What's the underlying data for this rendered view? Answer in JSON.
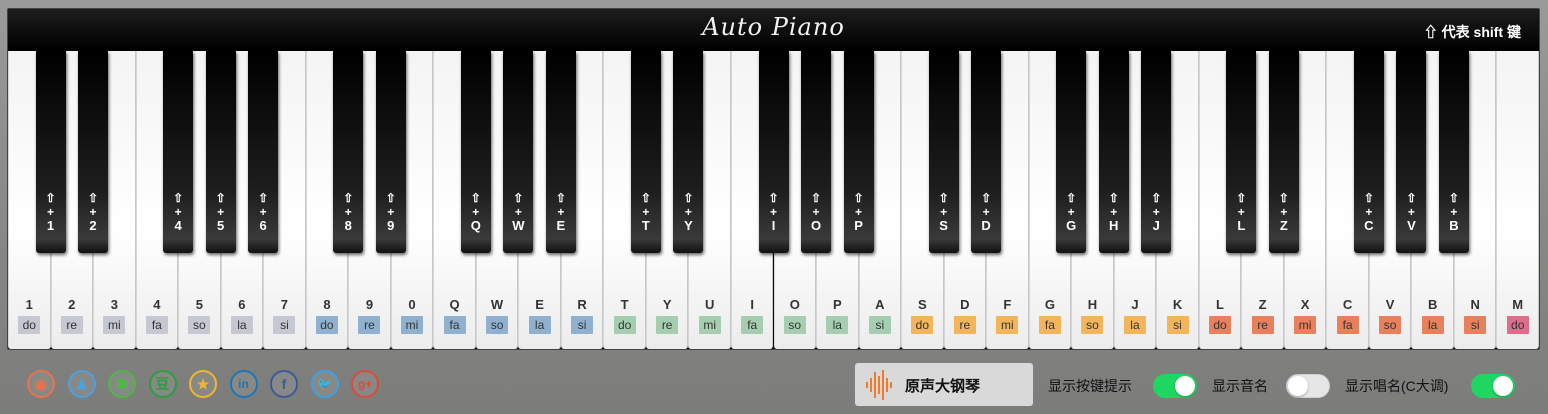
{
  "app": {
    "logo_text": "Auto Piano",
    "shift_hint": "⇧ 代表 shift 键"
  },
  "colors": {
    "group1": "#c5c8d2",
    "group2": "#8fb0cf",
    "group3": "#a5cdaf",
    "group4": "#f3b55b",
    "group5": "#e8805e",
    "last": "#e06c8c",
    "toggle_on": "#1ed760",
    "toggle_off": "#e6e6e6"
  },
  "white_keys": [
    {
      "char": "1",
      "note": "do",
      "group": 1
    },
    {
      "char": "2",
      "note": "re",
      "group": 1
    },
    {
      "char": "3",
      "note": "mi",
      "group": 1
    },
    {
      "char": "4",
      "note": "fa",
      "group": 1
    },
    {
      "char": "5",
      "note": "so",
      "group": 1
    },
    {
      "char": "6",
      "note": "la",
      "group": 1
    },
    {
      "char": "7",
      "note": "si",
      "group": 1
    },
    {
      "char": "8",
      "note": "do",
      "group": 2
    },
    {
      "char": "9",
      "note": "re",
      "group": 2
    },
    {
      "char": "0",
      "note": "mi",
      "group": 2
    },
    {
      "char": "Q",
      "note": "fa",
      "group": 2
    },
    {
      "char": "W",
      "note": "so",
      "group": 2
    },
    {
      "char": "E",
      "note": "la",
      "group": 2
    },
    {
      "char": "R",
      "note": "si",
      "group": 2
    },
    {
      "char": "T",
      "note": "do",
      "group": 3
    },
    {
      "char": "Y",
      "note": "re",
      "group": 3
    },
    {
      "char": "U",
      "note": "mi",
      "group": 3
    },
    {
      "char": "I",
      "note": "fa",
      "group": 3
    },
    {
      "char": "O",
      "note": "so",
      "group": 3
    },
    {
      "char": "P",
      "note": "la",
      "group": 3
    },
    {
      "char": "A",
      "note": "si",
      "group": 3
    },
    {
      "char": "S",
      "note": "do",
      "group": 4
    },
    {
      "char": "D",
      "note": "re",
      "group": 4
    },
    {
      "char": "F",
      "note": "mi",
      "group": 4
    },
    {
      "char": "G",
      "note": "fa",
      "group": 4
    },
    {
      "char": "H",
      "note": "so",
      "group": 4
    },
    {
      "char": "J",
      "note": "la",
      "group": 4
    },
    {
      "char": "K",
      "note": "si",
      "group": 4
    },
    {
      "char": "L",
      "note": "do",
      "group": 5
    },
    {
      "char": "Z",
      "note": "re",
      "group": 5
    },
    {
      "char": "X",
      "note": "mi",
      "group": 5
    },
    {
      "char": "C",
      "note": "fa",
      "group": 5
    },
    {
      "char": "V",
      "note": "so",
      "group": 5
    },
    {
      "char": "B",
      "note": "la",
      "group": 5
    },
    {
      "char": "N",
      "note": "si",
      "group": 5
    },
    {
      "char": "M",
      "note": "do",
      "group": 6
    }
  ],
  "black_keys": [
    {
      "after": 0,
      "shift": "⇧",
      "plus": "+",
      "char": "1"
    },
    {
      "after": 1,
      "shift": "⇧",
      "plus": "+",
      "char": "2"
    },
    {
      "after": 3,
      "shift": "⇧",
      "plus": "+",
      "char": "4"
    },
    {
      "after": 4,
      "shift": "⇧",
      "plus": "+",
      "char": "5"
    },
    {
      "after": 5,
      "shift": "⇧",
      "plus": "+",
      "char": "6"
    },
    {
      "after": 7,
      "shift": "⇧",
      "plus": "+",
      "char": "8"
    },
    {
      "after": 8,
      "shift": "⇧",
      "plus": "+",
      "char": "9"
    },
    {
      "after": 10,
      "shift": "⇧",
      "plus": "+",
      "char": "Q"
    },
    {
      "after": 11,
      "shift": "⇧",
      "plus": "+",
      "char": "W"
    },
    {
      "after": 12,
      "shift": "⇧",
      "plus": "+",
      "char": "E"
    },
    {
      "after": 14,
      "shift": "⇧",
      "plus": "+",
      "char": "T"
    },
    {
      "after": 15,
      "shift": "⇧",
      "plus": "+",
      "char": "Y"
    },
    {
      "after": 17,
      "shift": "⇧",
      "plus": "+",
      "char": "I"
    },
    {
      "after": 18,
      "shift": "⇧",
      "plus": "+",
      "char": "O"
    },
    {
      "after": 19,
      "shift": "⇧",
      "plus": "+",
      "char": "P"
    },
    {
      "after": 21,
      "shift": "⇧",
      "plus": "+",
      "char": "S"
    },
    {
      "after": 22,
      "shift": "⇧",
      "plus": "+",
      "char": "D"
    },
    {
      "after": 24,
      "shift": "⇧",
      "plus": "+",
      "char": "G"
    },
    {
      "after": 25,
      "shift": "⇧",
      "plus": "+",
      "char": "H"
    },
    {
      "after": 26,
      "shift": "⇧",
      "plus": "+",
      "char": "J"
    },
    {
      "after": 28,
      "shift": "⇧",
      "plus": "+",
      "char": "L"
    },
    {
      "after": 29,
      "shift": "⇧",
      "plus": "+",
      "char": "Z"
    },
    {
      "after": 31,
      "shift": "⇧",
      "plus": "+",
      "char": "C"
    },
    {
      "after": 32,
      "shift": "⇧",
      "plus": "+",
      "char": "V"
    },
    {
      "after": 33,
      "shift": "⇧",
      "plus": "+",
      "char": "B"
    }
  ],
  "social": [
    {
      "name": "weibo-icon",
      "glyph": "◉",
      "color": "#e8734a"
    },
    {
      "name": "qq-icon",
      "glyph": "♟",
      "color": "#4aa3df"
    },
    {
      "name": "wechat-icon",
      "glyph": "❁",
      "color": "#4cb846"
    },
    {
      "name": "douban-icon",
      "glyph": "豆",
      "color": "#2e9d3f"
    },
    {
      "name": "qzone-icon",
      "glyph": "★",
      "color": "#f0b62c"
    },
    {
      "name": "linkedin-icon",
      "glyph": "in",
      "color": "#1a78b9"
    },
    {
      "name": "facebook-icon",
      "glyph": "f",
      "color": "#3b5b98"
    },
    {
      "name": "twitter-icon",
      "glyph": "🐦",
      "color": "#3aa3e3"
    },
    {
      "name": "googleplus-icon",
      "glyph": "g+",
      "color": "#dc4b3e"
    }
  ],
  "controls": {
    "sound_label": "原声大钢琴",
    "show_key_hints_label": "显示按键提示",
    "show_key_hints_on": true,
    "show_note_names_label": "显示音名",
    "show_note_names_on": false,
    "show_solfege_label": "显示唱名(C大调)",
    "show_solfege_on": true
  }
}
